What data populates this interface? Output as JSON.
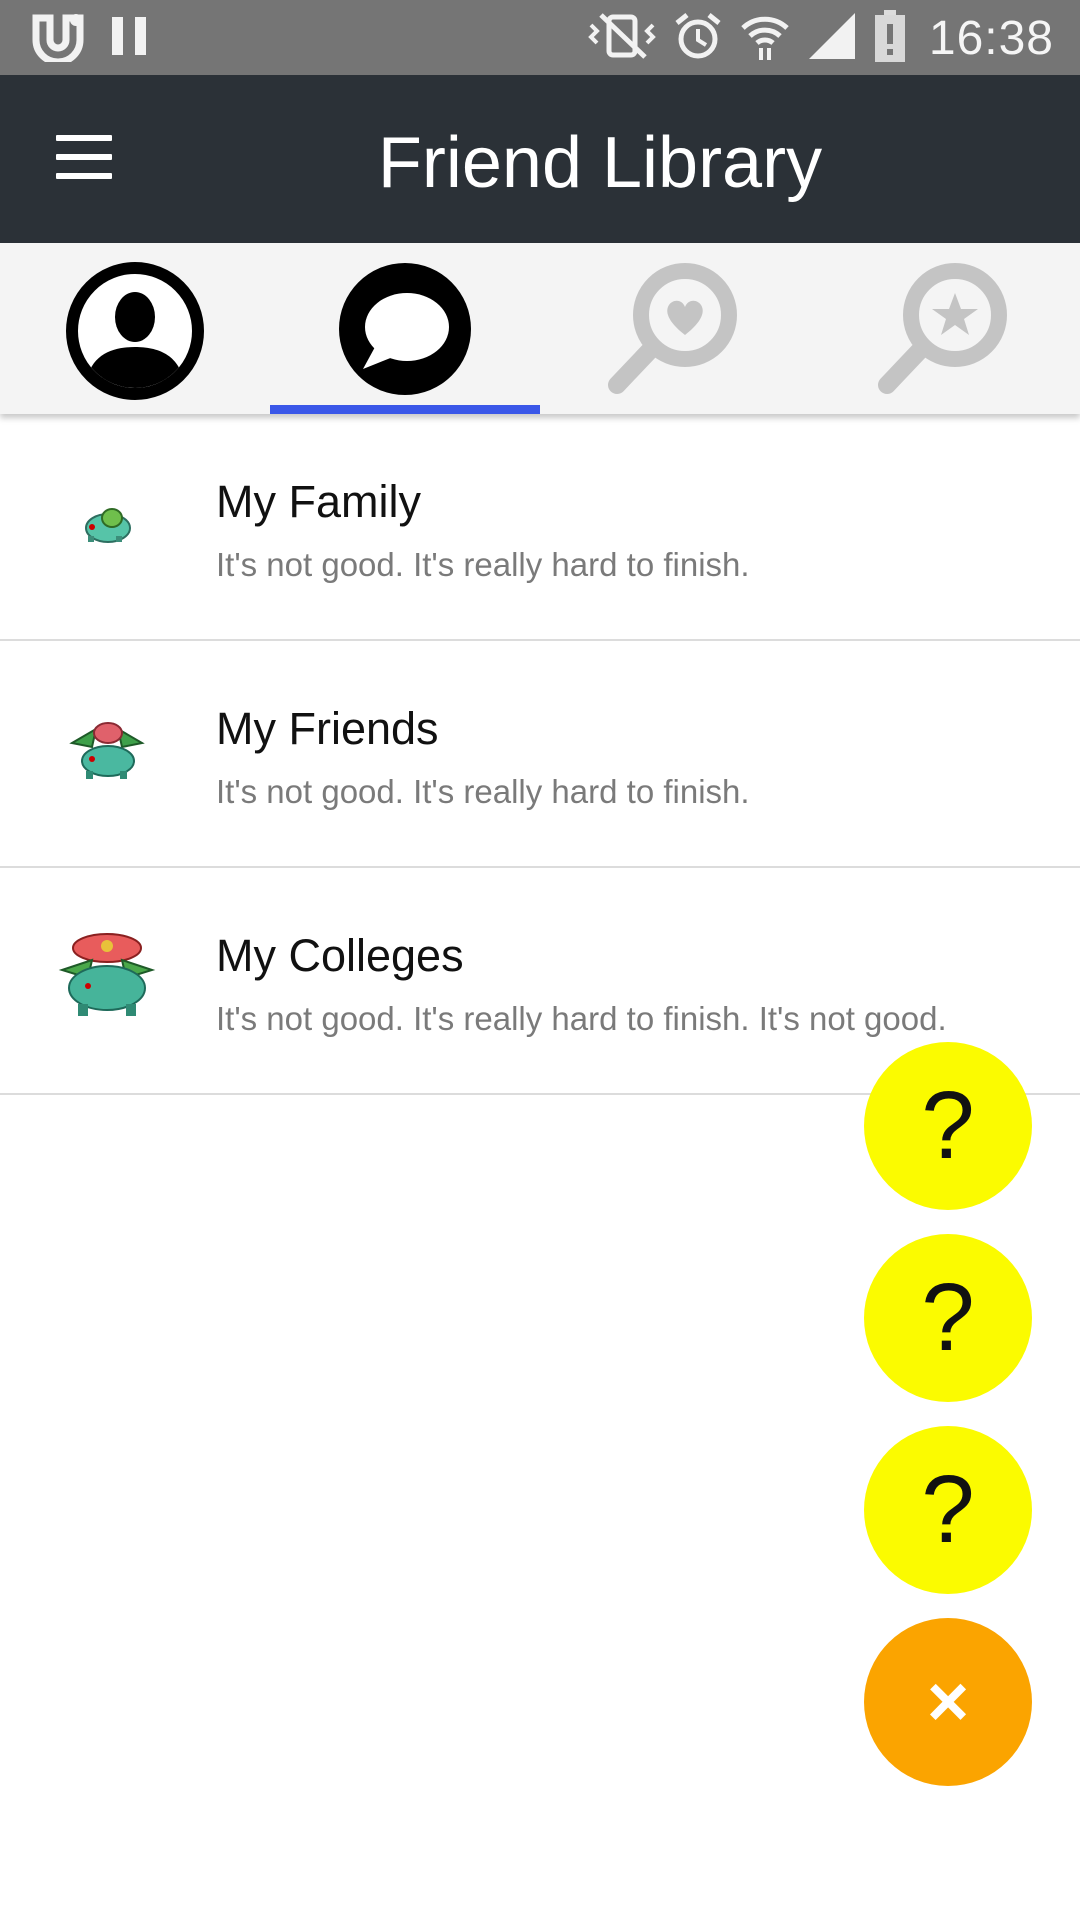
{
  "status_bar": {
    "time": "16:38",
    "icons": [
      "u-plus-icon",
      "pause-icon",
      "vibrate-off-icon",
      "alarm-icon",
      "wifi-icon",
      "signal-icon",
      "battery-alert-icon"
    ]
  },
  "app_bar": {
    "title": "Friend Library",
    "menu_icon": "hamburger-icon",
    "color": "#2b3137"
  },
  "tabs": [
    {
      "icon": "person-circle-icon",
      "active": false
    },
    {
      "icon": "chat-bubble-icon",
      "active": true
    },
    {
      "icon": "search-heart-icon",
      "active": false
    },
    {
      "icon": "search-star-icon",
      "active": false
    }
  ],
  "tab_indicator_color": "#3a57e8",
  "list": {
    "items": [
      {
        "title": "My Family",
        "subtitle": "It's not good. It's really hard to finish.",
        "avatar": "bulbasaur-avatar"
      },
      {
        "title": "My Friends",
        "subtitle": "It's not good. It's really hard to finish.",
        "avatar": "ivysaur-avatar"
      },
      {
        "title": "My Colleges",
        "subtitle": "It's not good. It's really hard to finish. It's not good.",
        "avatar": "venusaur-avatar"
      }
    ]
  },
  "fab": {
    "help_label": "?",
    "close_label": "×",
    "help_color": "#fbfb00",
    "close_color": "#fba400"
  }
}
